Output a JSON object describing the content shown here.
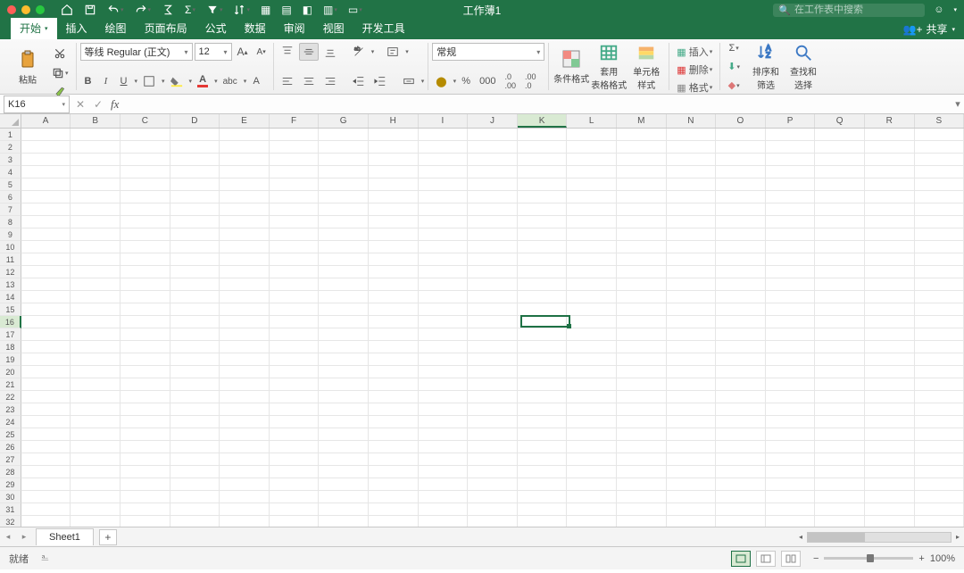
{
  "titlebar": {
    "title": "工作薄1",
    "search_placeholder": "在工作表中搜索"
  },
  "tabs": {
    "items": [
      "开始",
      "插入",
      "绘图",
      "页面布局",
      "公式",
      "数据",
      "审阅",
      "视图",
      "开发工具"
    ],
    "active": 0,
    "share": "共享"
  },
  "ribbon": {
    "paste": "粘贴",
    "font_name": "等线 Regular (正文)",
    "font_size": "12",
    "number_format": "常规",
    "percent": "%",
    "thousands": "000",
    "dec_inc": ".0",
    "dec_dec": ".00",
    "cond_fmt": "条件格式",
    "table_fmt": "套用\n表格格式",
    "cell_style": "单元格\n样式",
    "insert": "插入",
    "delete": "删除",
    "format": "格式",
    "sort": "排序和\n筛选",
    "find": "查找和\n选择"
  },
  "fx": {
    "cell_ref": "K16"
  },
  "grid": {
    "cols": [
      "A",
      "B",
      "C",
      "D",
      "E",
      "F",
      "G",
      "H",
      "I",
      "J",
      "K",
      "L",
      "M",
      "N",
      "O",
      "P",
      "Q",
      "R",
      "S"
    ],
    "rows": 32,
    "sel_col": "K",
    "sel_row": 16
  },
  "sheets": {
    "active": "Sheet1"
  },
  "status": {
    "ready": "就绪",
    "zoom": "100%"
  }
}
